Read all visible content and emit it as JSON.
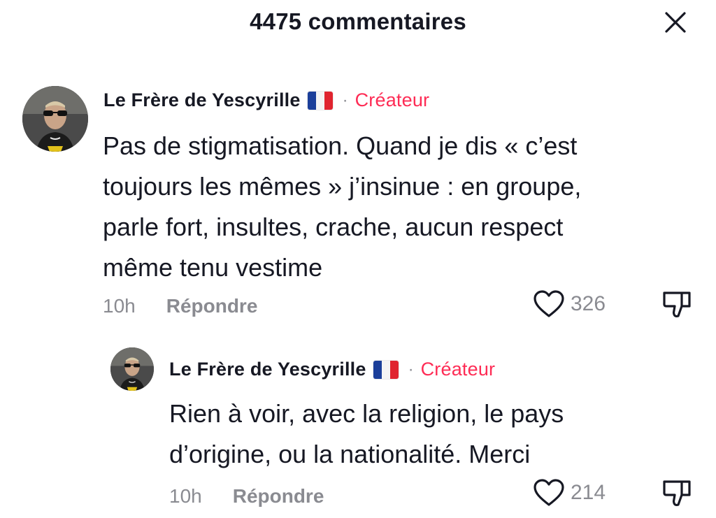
{
  "header": {
    "title": "4475 commentaires",
    "close_icon": "close-icon"
  },
  "colors": {
    "creator_badge": "#fe2c55",
    "secondary_text": "#8a8b91",
    "primary_text": "#161823"
  },
  "comments": [
    {
      "author": "Le Frère de Yescyrille",
      "flag": "france-flag-icon",
      "separator": "·",
      "badge": "Créateur",
      "lines": [
        "Pas de stigmatisation. Quand je dis «  c’est",
        "toujours les mêmes » j’insinue : en groupe,",
        "parle fort, insultes, crache, aucun respect",
        "même tenu vestime"
      ],
      "time": "10h",
      "reply_label": "Répondre",
      "likes": "326"
    },
    {
      "author": "Le Frère de Yescyrille",
      "flag": "france-flag-icon",
      "separator": "·",
      "badge": "Créateur",
      "lines": [
        "Rien à voir, avec la religion, le pays",
        "d’origine, ou la nationalité. Merci"
      ],
      "time": "10h",
      "reply_label": "Répondre",
      "likes": "214"
    }
  ]
}
